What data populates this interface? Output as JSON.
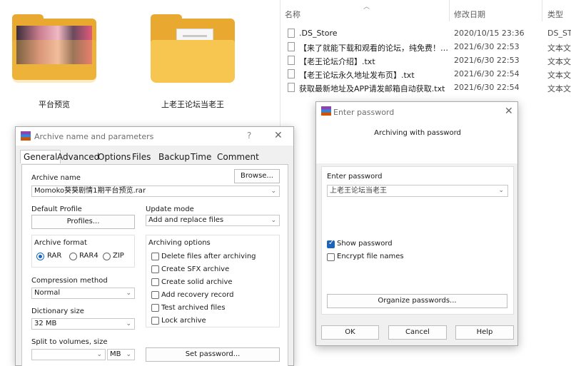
{
  "explorer_left": {
    "folders": [
      {
        "name": "平台预览"
      },
      {
        "name": "上老王论坛当老王"
      }
    ]
  },
  "explorer_right": {
    "columns": {
      "name": "名称",
      "date": "修改日期",
      "type": "类型"
    },
    "files": [
      {
        "name": ".DS_Store",
        "date": "2020/10/15 23:36",
        "type": "DS_STC"
      },
      {
        "name": "【来了就能下载和观看的论坛，纯免费！…",
        "date": "2021/6/30 22:53",
        "type": "文本文"
      },
      {
        "name": "【老王论坛介绍】.txt",
        "date": "2021/6/30 22:53",
        "type": "文本文"
      },
      {
        "name": "【老王论坛永久地址发布页】.txt",
        "date": "2021/6/30 22:54",
        "type": "文本文"
      },
      {
        "name": "获取最新地址及APP请发邮箱自动获取.txt",
        "date": "2021/6/30 22:54",
        "type": "文本文"
      }
    ]
  },
  "archive_dialog": {
    "title": "Archive name and parameters",
    "help": "?",
    "close": "✕",
    "tabs": [
      "General",
      "Advanced",
      "Options",
      "Files",
      "Backup",
      "Time",
      "Comment"
    ],
    "archive_name_label": "Archive name",
    "browse_label": "Browse...",
    "archive_name_value": "Momoko葵葵剧情1期平台预览.rar",
    "default_profile_label": "Default Profile",
    "profiles_label": "Profiles...",
    "update_mode_label": "Update mode",
    "update_mode_value": "Add and replace files",
    "archive_format_label": "Archive format",
    "formats": [
      "RAR",
      "RAR4",
      "ZIP"
    ],
    "selected_format": "RAR",
    "compression_label": "Compression method",
    "compression_value": "Normal",
    "dictionary_label": "Dictionary size",
    "dictionary_value": "32 MB",
    "split_label": "Split to volumes, size",
    "split_value": "",
    "split_unit": "MB",
    "archiving_options_label": "Archiving options",
    "options": [
      {
        "label": "Delete files after archiving",
        "checked": false
      },
      {
        "label": "Create SFX archive",
        "checked": false
      },
      {
        "label": "Create solid archive",
        "checked": false
      },
      {
        "label": "Add recovery record",
        "checked": false
      },
      {
        "label": "Test archived files",
        "checked": false
      },
      {
        "label": "Lock archive",
        "checked": false
      }
    ],
    "set_password_label": "Set password..."
  },
  "password_dialog": {
    "title": "Enter password",
    "close": "✕",
    "heading": "Archiving with password",
    "enter_password_label": "Enter password",
    "password_value": "上老王论坛当老王",
    "show_password_label": "Show password",
    "show_password_checked": true,
    "encrypt_names_label": "Encrypt file names",
    "encrypt_names_checked": false,
    "organize_label": "Organize passwords...",
    "ok_label": "OK",
    "cancel_label": "Cancel",
    "help_label": "Help"
  },
  "colors": {
    "folder": "#f7c651",
    "accent": "#1566c0"
  }
}
